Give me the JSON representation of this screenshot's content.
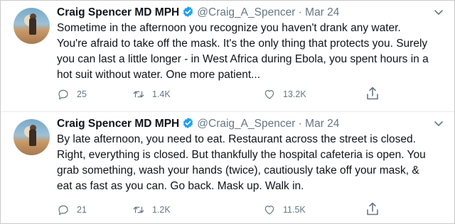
{
  "tweets": [
    {
      "author": "Craig Spencer MD MPH",
      "handle": "@Craig_A_Spencer",
      "separator": "·",
      "date": "Mar 24",
      "lines": [
        "Sometime in the afternoon you recognize you haven't drank any water.",
        "You're afraid to take off the mask. It's the only thing that protects you. Surely",
        "you can last a little longer - in West Africa during Ebola, you spent hours in a",
        "hot suit without water. One more patient..."
      ],
      "replies": "25",
      "retweets": "1.4K",
      "likes": "13.2K"
    },
    {
      "author": "Craig Spencer MD MPH",
      "handle": "@Craig_A_Spencer",
      "separator": "·",
      "date": "Mar 24",
      "lines": [
        "By late afternoon, you need to eat. Restaurant across the street is closed.",
        "Right, everything is closed. But thankfully the hospital cafeteria is open. You",
        "grab something, wash your hands (twice), cautiously take off your mask, &",
        "eat as fast as you can. Go back. Mask up. Walk in."
      ],
      "replies": "21",
      "retweets": "1.2K",
      "likes": "11.5K"
    }
  ],
  "icons": {
    "verified": "verified-badge-icon",
    "reply": "reply-icon",
    "retweet": "retweet-icon",
    "like": "heart-icon",
    "share": "share-icon",
    "more": "chevron-down-icon"
  },
  "colors": {
    "verified": "#1da1f2",
    "text": "#0f1419",
    "muted": "#657786"
  }
}
